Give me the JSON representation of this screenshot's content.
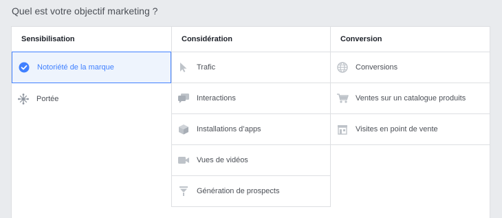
{
  "question": "Quel est votre objectif marketing ?",
  "columns": [
    {
      "title": "Sensibilisation",
      "items": [
        {
          "label": "Notoriété de la marque",
          "icon": "check-circle-icon",
          "selected": true
        },
        {
          "label": "Portée",
          "icon": "reach-icon",
          "selected": false
        }
      ]
    },
    {
      "title": "Considération",
      "items": [
        {
          "label": "Trafic",
          "icon": "cursor-icon"
        },
        {
          "label": "Interactions",
          "icon": "chat-bubbles-icon"
        },
        {
          "label": "Installations d’apps",
          "icon": "cube-icon"
        },
        {
          "label": "Vues de vidéos",
          "icon": "video-camera-icon"
        },
        {
          "label": "Génération de prospects",
          "icon": "funnel-icon"
        }
      ]
    },
    {
      "title": "Conversion",
      "items": [
        {
          "label": "Conversions",
          "icon": "globe-icon"
        },
        {
          "label": "Ventes sur un catalogue produits",
          "icon": "shopping-cart-icon"
        },
        {
          "label": "Visites en point de vente",
          "icon": "store-icon"
        }
      ]
    }
  ],
  "colors": {
    "accent": "#4080ff",
    "selected_bg": "#eef4fd",
    "icon_grey": "#bec3c9",
    "border": "#dddfe2"
  }
}
